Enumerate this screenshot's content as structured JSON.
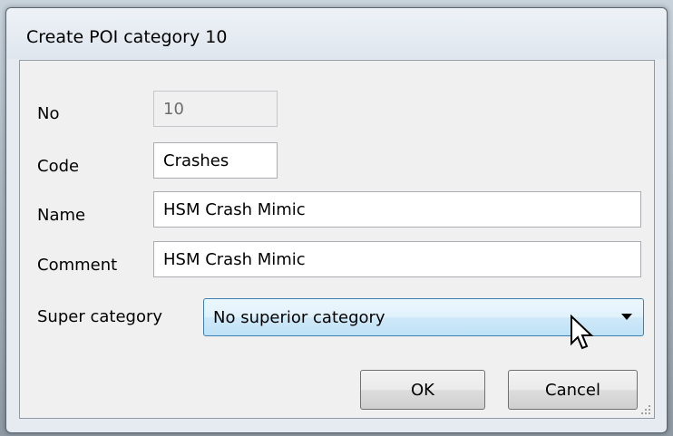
{
  "window": {
    "title": "Create POI category 10"
  },
  "form": {
    "no": {
      "label": "No",
      "value": "10"
    },
    "code": {
      "label": "Code",
      "value": "Crashes"
    },
    "name": {
      "label": "Name",
      "value": "HSM Crash Mimic"
    },
    "comment": {
      "label": "Comment",
      "value": "HSM Crash Mimic"
    },
    "super_category": {
      "label": "Super category",
      "value": "No superior category"
    }
  },
  "buttons": {
    "ok": "OK",
    "cancel": "Cancel"
  },
  "icons": {
    "dropdown": "chevron-down-icon",
    "cursor": "mouse-pointer-icon",
    "grip": "resize-grip-icon"
  }
}
